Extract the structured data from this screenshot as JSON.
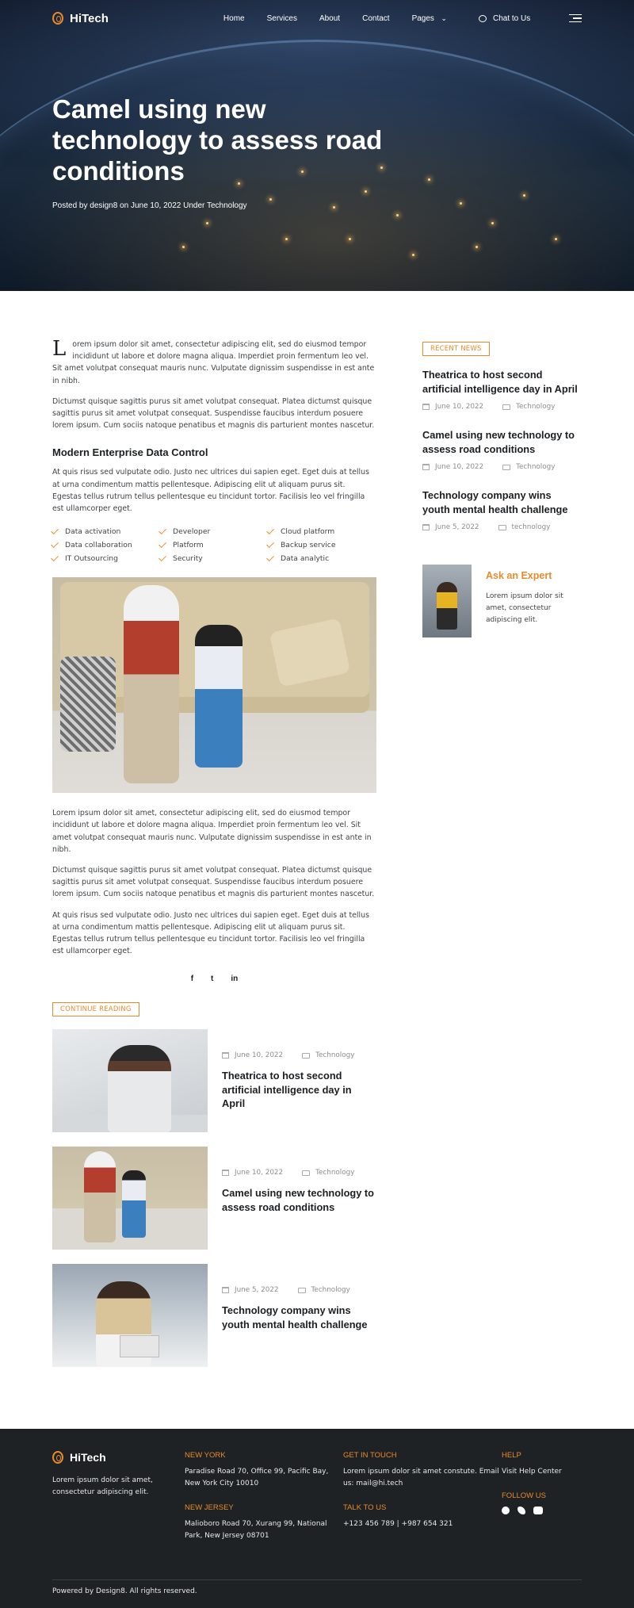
{
  "brand": {
    "name": "HiTech",
    "accent": "#e88a2b",
    "dark": "#1e2224"
  },
  "nav": {
    "links": [
      "Home",
      "Services",
      "About",
      "Contact",
      "Pages"
    ],
    "chat_label": "Chat to Us"
  },
  "hero": {
    "title": "Camel using new technology to assess road conditions",
    "meta": "Posted by design8 on June 10, 2022 Under Technology"
  },
  "article": {
    "dropcap": "L",
    "p1": "orem ipsum dolor sit amet, consectetur adipiscing elit, sed do eiusmod tempor incididunt ut labore et dolore magna aliqua. Imperdiet proin fermentum leo vel. Sit amet volutpat consequat mauris nunc. Vulputate dignissim suspendisse in est ante in nibh.",
    "p2": "Dictumst quisque sagittis purus sit amet volutpat consequat. Platea dictumst quisque sagittis purus sit amet volutpat consequat. Suspendisse faucibus interdum posuere lorem ipsum. Cum sociis natoque penatibus et magnis dis parturient montes nascetur.",
    "subheading": "Modern Enterprise Data Control",
    "p3": "At quis risus sed vulputate odio. Justo nec ultrices dui sapien eget. Eget duis at tellus at urna condimentum mattis pellentesque. Adipiscing elit ut aliquam purus sit. Egestas tellus rutrum tellus pellentesque eu tincidunt tortor. Facilisis leo vel fringilla est ullamcorper eget.",
    "features": [
      "Data activation",
      "Developer",
      "Cloud platform",
      "Data collaboration",
      "Platform",
      "Backup service",
      "IT Outsourcing",
      "Security",
      "Data analytic"
    ],
    "p4": "Lorem ipsum dolor sit amet, consectetur adipiscing elit, sed do eiusmod tempor incididunt ut labore et dolore magna aliqua. Imperdiet proin fermentum leo vel. Sit amet volutpat consequat mauris nunc. Vulputate dignissim suspendisse in est ante in nibh.",
    "p5": "Dictumst quisque sagittis purus sit amet volutpat consequat. Platea dictumst quisque sagittis purus sit amet volutpat consequat. Suspendisse faucibus interdum posuere lorem ipsum. Cum sociis natoque penatibus et magnis dis parturient montes nascetur.",
    "p6": "At quis risus sed vulputate odio. Justo nec ultrices dui sapien eget. Eget duis at tellus at urna condimentum mattis pellentesque. Adipiscing elit ut aliquam purus sit. Egestas tellus rutrum tellus pellentesque eu tincidunt tortor. Facilisis leo vel fringilla est ullamcorper eget.",
    "share": [
      "f",
      "t",
      "in"
    ],
    "continue_label": "CONTINUE READING"
  },
  "related": [
    {
      "date": "June 10, 2022",
      "category": "Technology",
      "title": "Theatrica to host second artificial intelligence day in April"
    },
    {
      "date": "June 10, 2022",
      "category": "Technology",
      "title": "Camel using new technology to assess road conditions"
    },
    {
      "date": "June 5, 2022",
      "category": "Technology",
      "title": "Technology company wins youth mental health challenge"
    }
  ],
  "sidebar": {
    "recent_label": "RECENT NEWS",
    "items": [
      {
        "title": "Theatrica to host second artificial intelligence day in April",
        "date": "June 10, 2022",
        "category": "Technology"
      },
      {
        "title": "Camel using new technology to assess road conditions",
        "date": "June 10, 2022",
        "category": "Technology"
      },
      {
        "title": "Technology company wins youth mental health challenge",
        "date": "June 5, 2022",
        "category": "technology"
      }
    ],
    "expert_title": "Ask an Expert",
    "expert_text": "Lorem ipsum dolor sit amet, consectetur adipiscing elit."
  },
  "footer": {
    "about": "Lorem ipsum dolor sit amet, consectetur adipiscing elit.",
    "new_york_label": "NEW YORK",
    "new_york": "Paradise Road 70, Office 99, Pacific Bay,  New York City 10010",
    "new_jersey_label": "NEW JERSEY",
    "new_jersey": "Malioboro Road 70, Xurang 99, National Park, New Jersey 08701",
    "touch_label": "GET IN TOUCH",
    "touch": "Lorem ipsum dolor sit amet constute. Email us: mail@hi.tech",
    "talk_label": "TALK TO US",
    "talk": "+123 456 789 | +987 654 321",
    "help_label": "HELP",
    "help_link": "Visit Help Center",
    "follow_label": "FOLLOW US",
    "copyright": "Powered by Design8. All rights reserved."
  }
}
